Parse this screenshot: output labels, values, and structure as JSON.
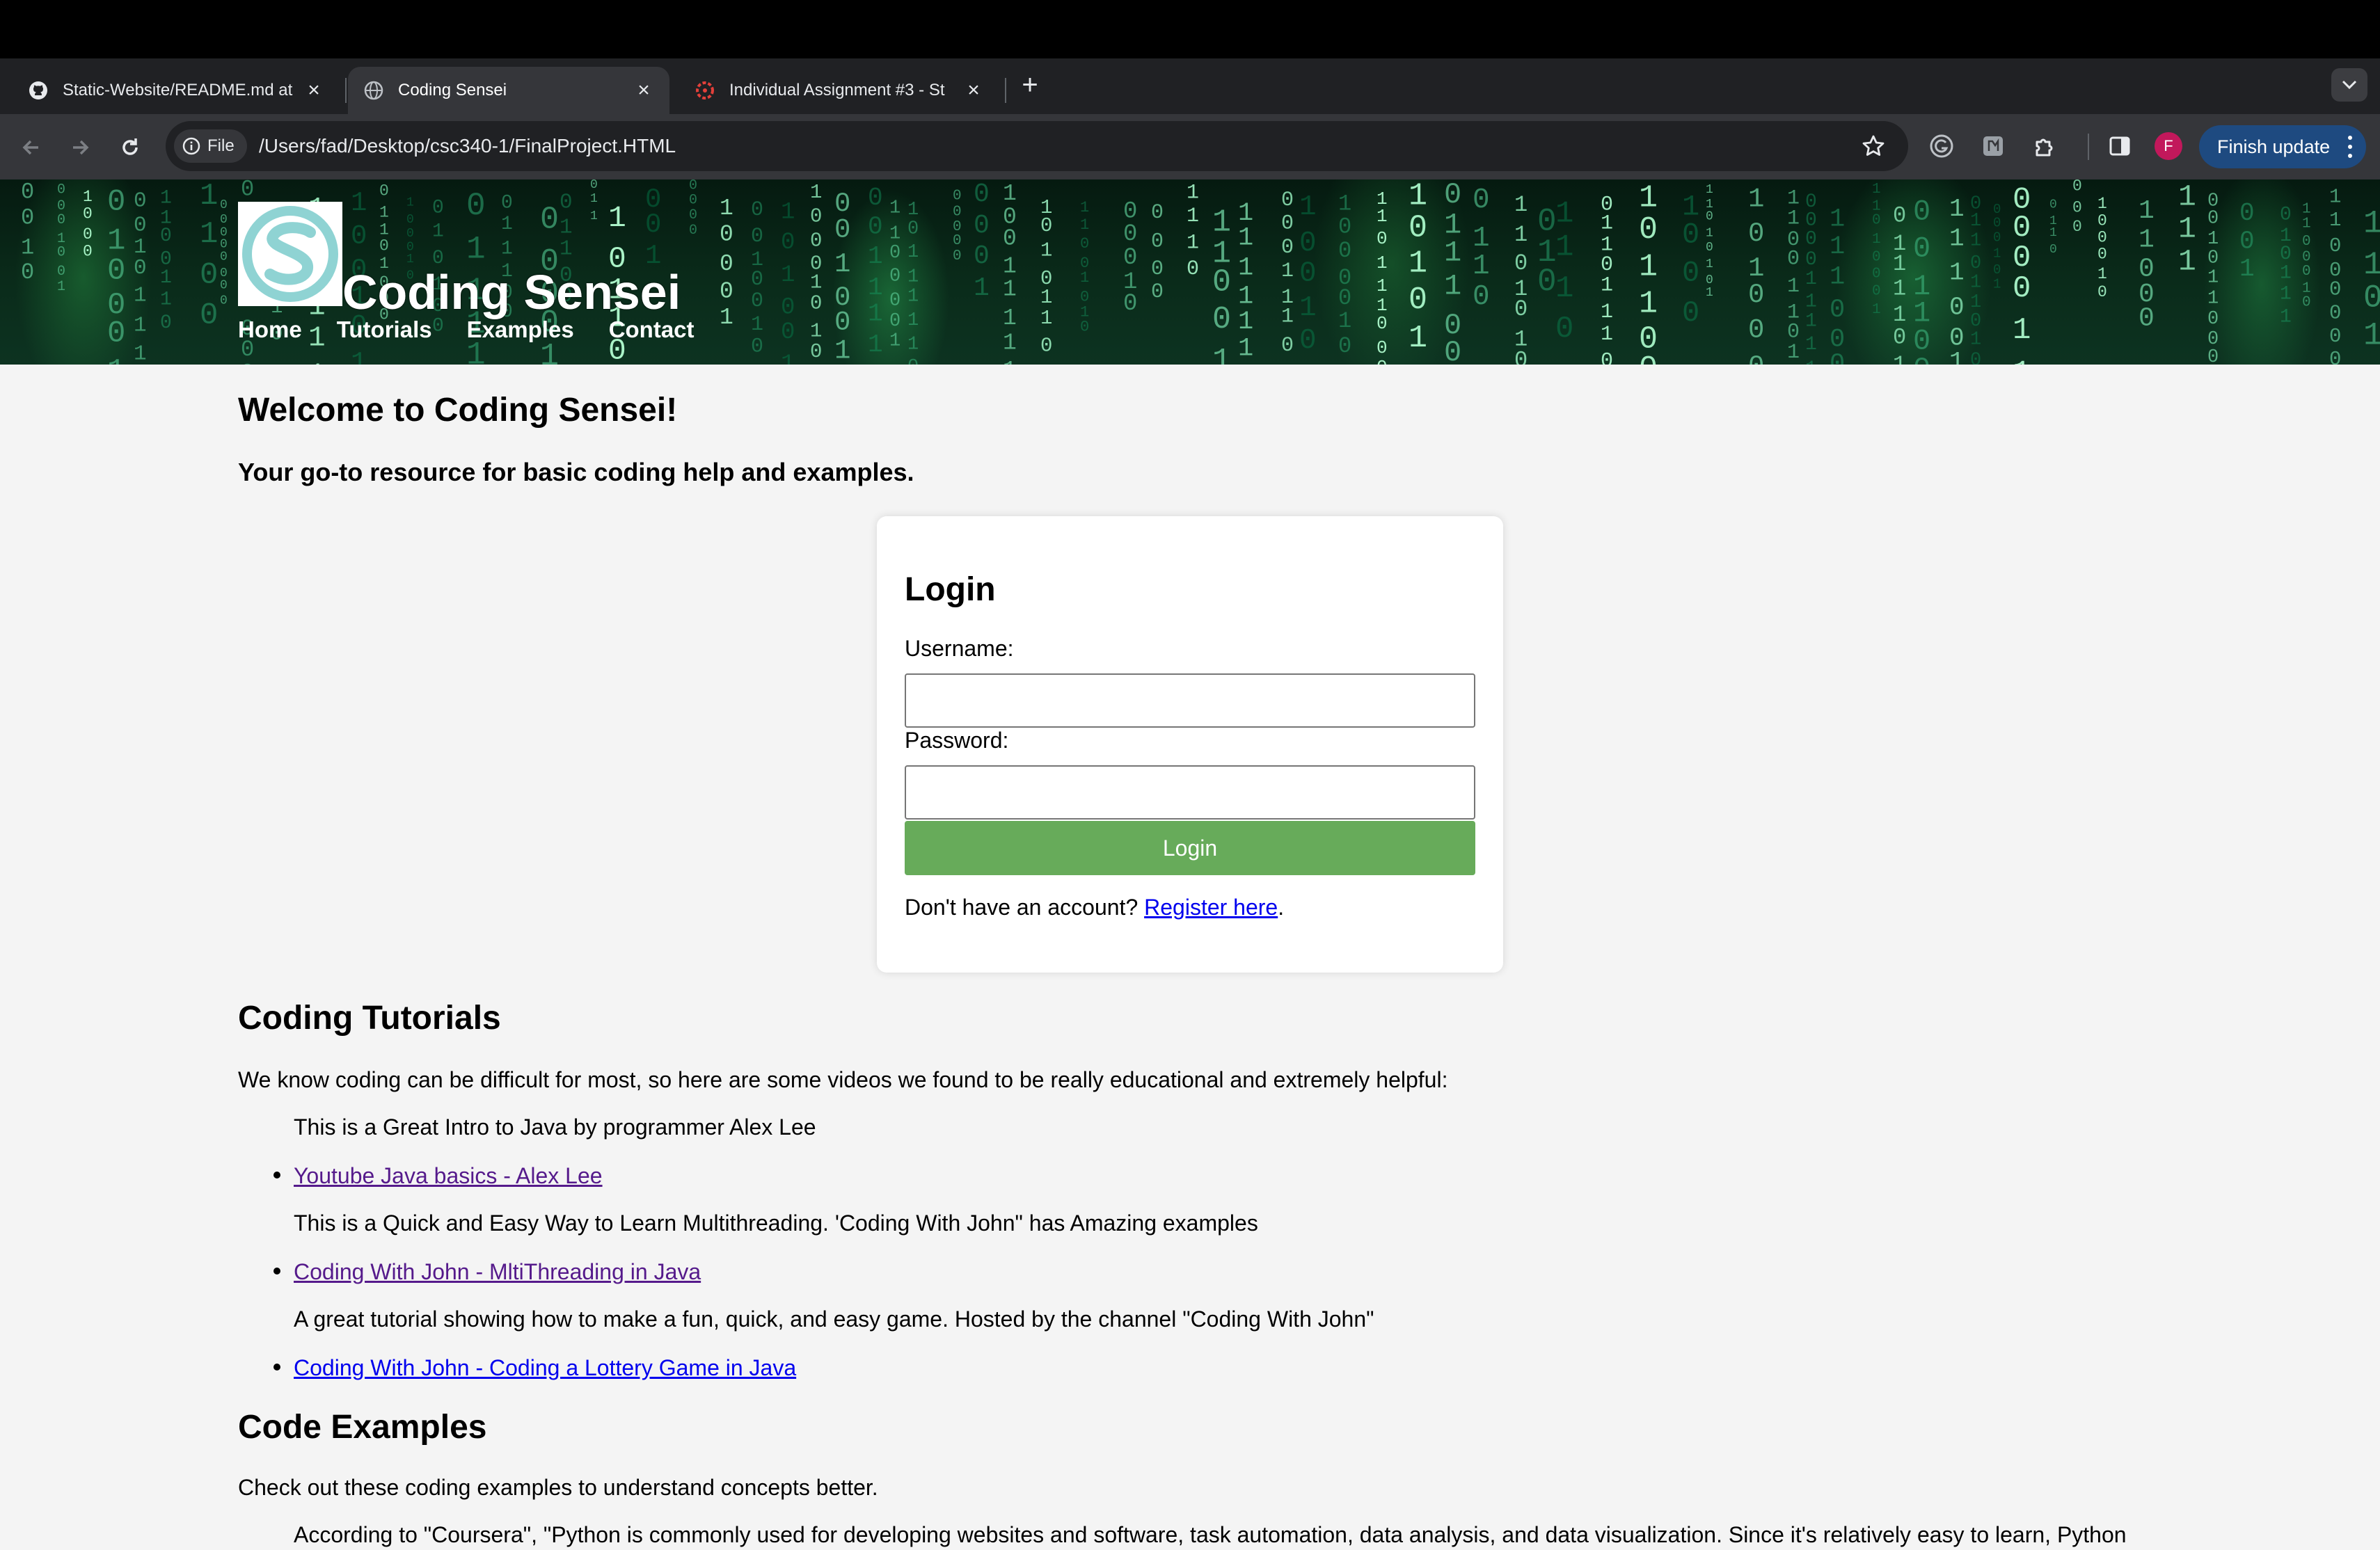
{
  "browser": {
    "tabs": [
      {
        "title": "Static-Website/README.md at",
        "favicon": "github-icon"
      },
      {
        "title": "Coding Sensei",
        "favicon": "globe-icon"
      },
      {
        "title": "Individual Assignment #3 - St",
        "favicon": "canvas-icon"
      }
    ],
    "file_chip": "File",
    "url": "/Users/fad/Desktop/csc340-1/FinalProject.HTML",
    "avatar_letter": "F",
    "update_button": "Finish update"
  },
  "site": {
    "title": "Coding Sensei",
    "nav": [
      "Home",
      "Tutorials",
      "Examples",
      "Contact"
    ]
  },
  "main": {
    "heading": "Welcome to Coding Sensei!",
    "subheading": "Your go-to resource for basic coding help and examples."
  },
  "login": {
    "title": "Login",
    "username_label": "Username:",
    "password_label": "Password:",
    "username_value": "",
    "password_value": "",
    "button": "Login",
    "register_prefix": "Don't have an account?",
    "register_link": "Register here",
    "register_suffix": "."
  },
  "tutorials": {
    "heading": "Coding Tutorials",
    "intro": "We know coding can be difficult for most, so here are some videos we found to be really educational and extremely helpful:",
    "items": [
      {
        "description": "This is a Great Intro to Java by programmer Alex Lee",
        "link": "Youtube Java basics - Alex Lee"
      },
      {
        "description": "This is a Quick and Easy Way to Learn Multithreading. 'Coding With John\" has Amazing examples",
        "link": "Coding With John - MltiThreading in Java"
      },
      {
        "description": "A great tutorial showing how to make a fun, quick, and easy game. Hosted by the channel \"Coding With John\"",
        "link": "Coding With John - Coding a Lottery Game in Java"
      }
    ]
  },
  "examples": {
    "heading": "Code Examples",
    "intro": "Check out these coding examples to understand concepts better.",
    "quote": "According to \"Coursera\", \"Python is commonly used for developing websites and software, task automation, data analysis, and data visualization. Since it's relatively easy to learn, Python"
  }
}
